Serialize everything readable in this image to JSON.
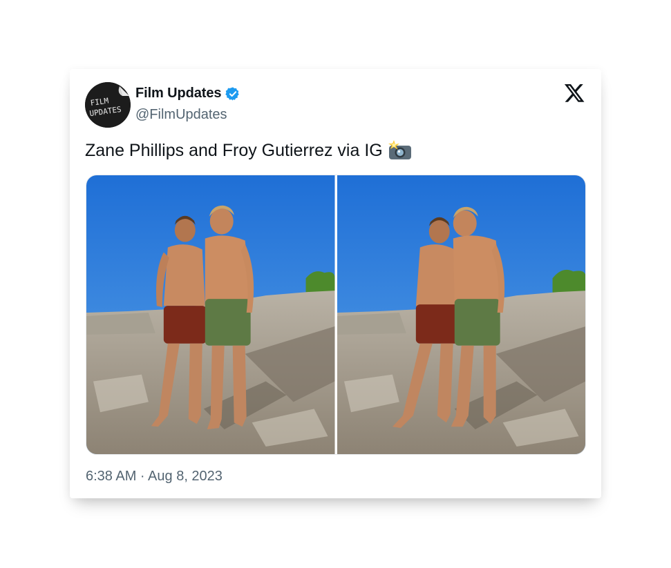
{
  "tweet": {
    "author": {
      "display_name": "Film Updates",
      "handle": "@FilmUpdates",
      "verified": true,
      "avatar_text_line1": "FILM",
      "avatar_text_line2": "UPDATES"
    },
    "text": "Zane Phillips and Froy Gutierrez via IG",
    "emoji_icon": "camera-flash-icon",
    "media": [
      {
        "kind": "photo",
        "description_icon": "beach-photo-icon"
      },
      {
        "kind": "photo",
        "description_icon": "beach-photo-icon"
      }
    ],
    "timestamp": "6:38 AM · Aug 8, 2023"
  },
  "brand": {
    "logo_icon": "x-logo-icon",
    "verified_color": "#1d9bf0",
    "text_primary": "#0f1419",
    "text_secondary": "#536471"
  }
}
